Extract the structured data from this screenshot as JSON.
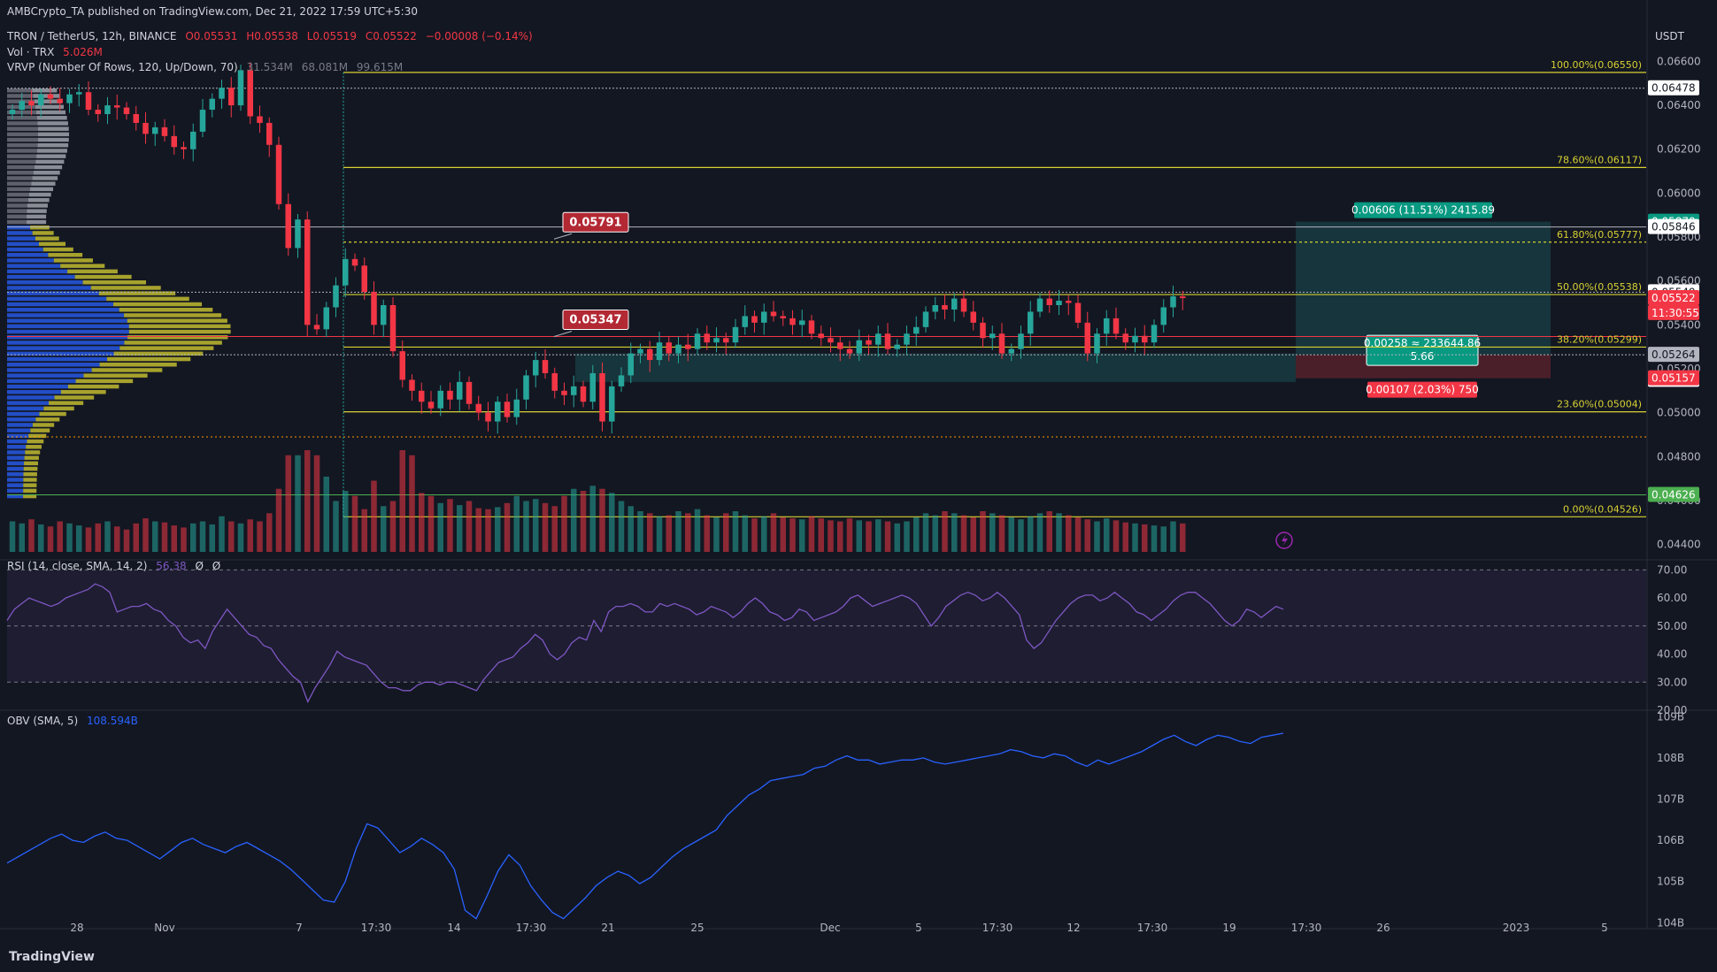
{
  "header": {
    "published": "AMBCrypto_TA published on TradingView.com, Dec 21, 2022 17:59 UTC+5:30",
    "symbol": "TRON / TetherUS, 12h, BINANCE",
    "ohlc_o": "O0.05531",
    "ohlc_h": "H0.05538",
    "ohlc_l": "L0.05519",
    "ohlc_c": "C0.05522",
    "change": "−0.00008 (−0.14%)",
    "vol_label": "Vol · TRX",
    "vol_value": "5.026M",
    "vrvp_label": "VRVP (Number Of Rows, 120, Up/Down, 70)",
    "vrvp_v1": "31.534M",
    "vrvp_v2": "68.081M",
    "vrvp_v3": "99.615M",
    "rsi_label": "RSI (14, close, SMA, 14, 2)",
    "rsi_value": "56.38",
    "rsi_n1": "Ø",
    "rsi_n2": "Ø",
    "obv_label": "OBV (SMA, 5)",
    "obv_value": "108.594B",
    "currency": "USDT",
    "footer_logo": "TradingView"
  },
  "colors": {
    "background": "#131722",
    "up": "#26a69a",
    "down": "#f23645",
    "fib": "#d8d132",
    "profile_up": "#2962ff",
    "profile_down": "#d8d132",
    "rsi": "#7e57c2",
    "obv": "#2962ff",
    "target_zone": "#26a69a",
    "stop_zone": "#f23645"
  },
  "chart_data": [
    {
      "type": "candlestick",
      "title": "TRON / TetherUS, 12h, BINANCE",
      "ylabel": "USDT",
      "ylim": [
        0.0435,
        0.0663
      ],
      "y_ticks": [
        "0.06600",
        "0.06400",
        "0.06200",
        "0.06000",
        "0.05800",
        "0.05600",
        "0.05400",
        "0.05200",
        "0.05000",
        "0.04800",
        "0.04600",
        "0.04400"
      ],
      "x_ticks": [
        "28",
        "Nov",
        "7",
        "17:30",
        "14",
        "17:30",
        "21",
        "25",
        "Dec",
        "5",
        "17:30",
        "12",
        "17:30",
        "19",
        "17:30",
        "26",
        "2023",
        "5"
      ],
      "closes_approx": [
        0.0638,
        0.0642,
        0.064,
        0.0645,
        0.0643,
        0.0641,
        0.0645,
        0.0646,
        0.0638,
        0.0636,
        0.064,
        0.0639,
        0.0636,
        0.0632,
        0.0627,
        0.063,
        0.0626,
        0.0621,
        0.062,
        0.0628,
        0.0638,
        0.0643,
        0.0648,
        0.064,
        0.0656,
        0.0635,
        0.0632,
        0.0622,
        0.0595,
        0.0575,
        0.0588,
        0.054,
        0.0538,
        0.0548,
        0.0558,
        0.057,
        0.0567,
        0.0555,
        0.054,
        0.0549,
        0.0528,
        0.0515,
        0.051,
        0.0505,
        0.0502,
        0.051,
        0.0506,
        0.0514,
        0.0504,
        0.05,
        0.0496,
        0.0505,
        0.0498,
        0.0506,
        0.0517,
        0.0524,
        0.0518,
        0.051,
        0.0508,
        0.0512,
        0.0505,
        0.0518,
        0.0496,
        0.0512,
        0.0517,
        0.0527,
        0.0529,
        0.0524,
        0.0532,
        0.0527,
        0.0531,
        0.0529,
        0.0536,
        0.0532,
        0.0534,
        0.0532,
        0.0539,
        0.0544,
        0.0541,
        0.0546,
        0.0544,
        0.0543,
        0.054,
        0.0542,
        0.0536,
        0.0534,
        0.0532,
        0.0529,
        0.0527,
        0.0533,
        0.0531,
        0.0536,
        0.0529,
        0.0531,
        0.0536,
        0.0539,
        0.0546,
        0.0549,
        0.0547,
        0.0552,
        0.0546,
        0.0541,
        0.0534,
        0.0536,
        0.0527,
        0.0529,
        0.0536,
        0.0546,
        0.0552,
        0.0549,
        0.0551,
        0.055,
        0.0541,
        0.0527,
        0.0536,
        0.0543,
        0.0536,
        0.0532,
        0.0535,
        0.0532,
        0.054,
        0.0548,
        0.0553,
        0.05522
      ],
      "volume_approx": [
        0.3,
        0.28,
        0.32,
        0.27,
        0.25,
        0.3,
        0.28,
        0.26,
        0.24,
        0.28,
        0.3,
        0.25,
        0.22,
        0.28,
        0.33,
        0.3,
        0.29,
        0.26,
        0.24,
        0.28,
        0.3,
        0.27,
        0.35,
        0.3,
        0.28,
        0.32,
        0.3,
        0.38,
        0.62,
        0.95,
        0.95,
        1.0,
        0.95,
        0.74,
        0.5,
        0.6,
        0.55,
        0.42,
        0.7,
        0.45,
        0.5,
        1.0,
        0.95,
        0.58,
        0.55,
        0.48,
        0.52,
        0.46,
        0.5,
        0.43,
        0.42,
        0.44,
        0.48,
        0.55,
        0.5,
        0.52,
        0.48,
        0.45,
        0.55,
        0.62,
        0.6,
        0.65,
        0.62,
        0.58,
        0.5,
        0.45,
        0.4,
        0.38,
        0.35,
        0.36,
        0.4,
        0.38,
        0.42,
        0.36,
        0.34,
        0.38,
        0.4,
        0.36,
        0.33,
        0.35,
        0.38,
        0.34,
        0.33,
        0.32,
        0.35,
        0.33,
        0.31,
        0.3,
        0.33,
        0.31,
        0.3,
        0.32,
        0.3,
        0.28,
        0.3,
        0.34,
        0.38,
        0.36,
        0.4,
        0.38,
        0.36,
        0.34,
        0.4,
        0.38,
        0.36,
        0.34,
        0.32,
        0.35,
        0.38,
        0.4,
        0.38,
        0.36,
        0.34,
        0.32,
        0.3,
        0.33,
        0.31,
        0.29,
        0.28,
        0.27,
        0.26,
        0.25
      ],
      "fibonacci": [
        {
          "label": "100.00%(0.06550)",
          "price": 0.0655
        },
        {
          "label": "78.60%(0.06117)",
          "price": 0.06117
        },
        {
          "label": "61.80%(0.05777)",
          "price": 0.05777
        },
        {
          "label": "50.00%(0.05538)",
          "price": 0.05538
        },
        {
          "label": "38.20%(0.05299)",
          "price": 0.05299
        },
        {
          "label": "23.60%(0.05004)",
          "price": 0.05004
        },
        {
          "label": "0.00%(0.04526)",
          "price": 0.04526
        }
      ],
      "price_tags": [
        {
          "label": "0.06478",
          "price": 0.06478,
          "color": "#ffffff",
          "text": "#131722"
        },
        {
          "label": "0.05870",
          "price": 0.0587,
          "color": "#089981",
          "text": "#ffffff"
        },
        {
          "label": "0.05846",
          "price": 0.05846,
          "color": "#ffffff",
          "text": "#131722"
        },
        {
          "label": "0.05549",
          "price": 0.05549,
          "color": "#ffffff",
          "text": "#131722"
        },
        {
          "label": "0.05522",
          "price": 0.05522,
          "color": "#f23645",
          "text": "#ffffff"
        },
        {
          "label": "11:30:55",
          "price": 0.05454,
          "color": "#f23645",
          "text": "#ffffff"
        },
        {
          "label": "0.05264",
          "price": 0.05264,
          "color": "#b2b5be",
          "text": "#131722"
        },
        {
          "label": "0.05264",
          "price": 0.0515,
          "color": "#ffffff",
          "text": "#131722"
        },
        {
          "label": "0.05157",
          "price": 0.05157,
          "color": "#f23645",
          "text": "#ffffff"
        },
        {
          "label": "0.04626",
          "price": 0.04626,
          "color": "#4caf50",
          "text": "#ffffff"
        }
      ],
      "annotations": [
        {
          "label": "0.05791",
          "price": 0.05791
        },
        {
          "label": "0.05347",
          "price": 0.05347
        }
      ],
      "position": {
        "entry": 0.05264,
        "target": 0.0587,
        "stop": 0.05157,
        "target_label": "0.00606 (11.51%) 2415.89",
        "entry_label_1": "0.00258 ≈ 233644.86",
        "entry_label_2": "5.66",
        "stop_label": "0.00107 (2.03%) 750"
      }
    },
    {
      "type": "line",
      "title": "RSI (14, close, SMA, 14, 2)",
      "ylim": [
        20,
        72
      ],
      "y_ticks": [
        "70.00",
        "60.00",
        "50.00",
        "40.00",
        "30.00",
        "20.00"
      ],
      "bands": [
        30,
        50,
        70
      ],
      "values": [
        52,
        56,
        58,
        60,
        59,
        58,
        57,
        58,
        60,
        61,
        62,
        63,
        65,
        64,
        62,
        55,
        56,
        57,
        57,
        58,
        56,
        55,
        52,
        50,
        46,
        44,
        45,
        42,
        48,
        52,
        56,
        53,
        50,
        47,
        46,
        43,
        42,
        38,
        35,
        32,
        30,
        23,
        28,
        32,
        36,
        41,
        39,
        38,
        37,
        36,
        33,
        30,
        28,
        28,
        27,
        27,
        29,
        30,
        30,
        29,
        30,
        30,
        29,
        28,
        27,
        31,
        34,
        37,
        38,
        39,
        42,
        44,
        47,
        45,
        40,
        38,
        40,
        44,
        46,
        45,
        52,
        48,
        55,
        57,
        57,
        58,
        57,
        55,
        55,
        58,
        57,
        58,
        57,
        56,
        54,
        55,
        57,
        56,
        55,
        53,
        55,
        58,
        60,
        58,
        55,
        54,
        52,
        53,
        56,
        55,
        52,
        53,
        54,
        55,
        57,
        60,
        61,
        59,
        57,
        58,
        59,
        60,
        61,
        60,
        58,
        54,
        50,
        53,
        57,
        59,
        61,
        62,
        61,
        59,
        60,
        62,
        60,
        57,
        54,
        45,
        42,
        44,
        48,
        52,
        55,
        58,
        60,
        61,
        61,
        59,
        60,
        62,
        60,
        58,
        55,
        54,
        52,
        54,
        56,
        59,
        61,
        62,
        62,
        60,
        58,
        55,
        52,
        50,
        52,
        56,
        55,
        53,
        55,
        57,
        56
      ],
      "current": 56.38
    },
    {
      "type": "line",
      "title": "OBV (SMA, 5)",
      "ylim": [
        103.9,
        109.05
      ],
      "y_ticks": [
        "109B",
        "108B",
        "107B",
        "106B",
        "105B",
        "104B"
      ],
      "values": [
        105.45,
        105.6,
        105.75,
        105.9,
        106.05,
        106.15,
        106.0,
        105.95,
        106.1,
        106.2,
        106.05,
        106.0,
        105.85,
        105.7,
        105.55,
        105.75,
        105.95,
        106.05,
        105.9,
        105.8,
        105.7,
        105.85,
        105.95,
        105.8,
        105.65,
        105.5,
        105.3,
        105.05,
        104.8,
        104.55,
        104.5,
        105.0,
        105.8,
        106.4,
        106.3,
        106.0,
        105.7,
        105.85,
        106.05,
        105.9,
        105.7,
        105.3,
        104.3,
        104.1,
        104.65,
        105.25,
        105.65,
        105.4,
        104.9,
        104.55,
        104.25,
        104.1,
        104.35,
        104.6,
        104.9,
        105.1,
        105.25,
        105.15,
        104.95,
        105.1,
        105.35,
        105.6,
        105.8,
        105.95,
        106.1,
        106.25,
        106.6,
        106.85,
        107.1,
        107.25,
        107.45,
        107.5,
        107.55,
        107.6,
        107.75,
        107.8,
        107.95,
        108.05,
        107.95,
        107.95,
        107.85,
        107.9,
        107.95,
        107.95,
        108.0,
        107.9,
        107.85,
        107.9,
        107.95,
        108.0,
        108.05,
        108.1,
        108.2,
        108.15,
        108.05,
        108.0,
        108.1,
        108.05,
        107.9,
        107.8,
        107.95,
        107.85,
        107.95,
        108.05,
        108.15,
        108.3,
        108.45,
        108.55,
        108.4,
        108.3,
        108.45,
        108.55,
        108.5,
        108.4,
        108.35,
        108.5,
        108.55,
        108.6
      ],
      "current": "108.594B"
    }
  ]
}
